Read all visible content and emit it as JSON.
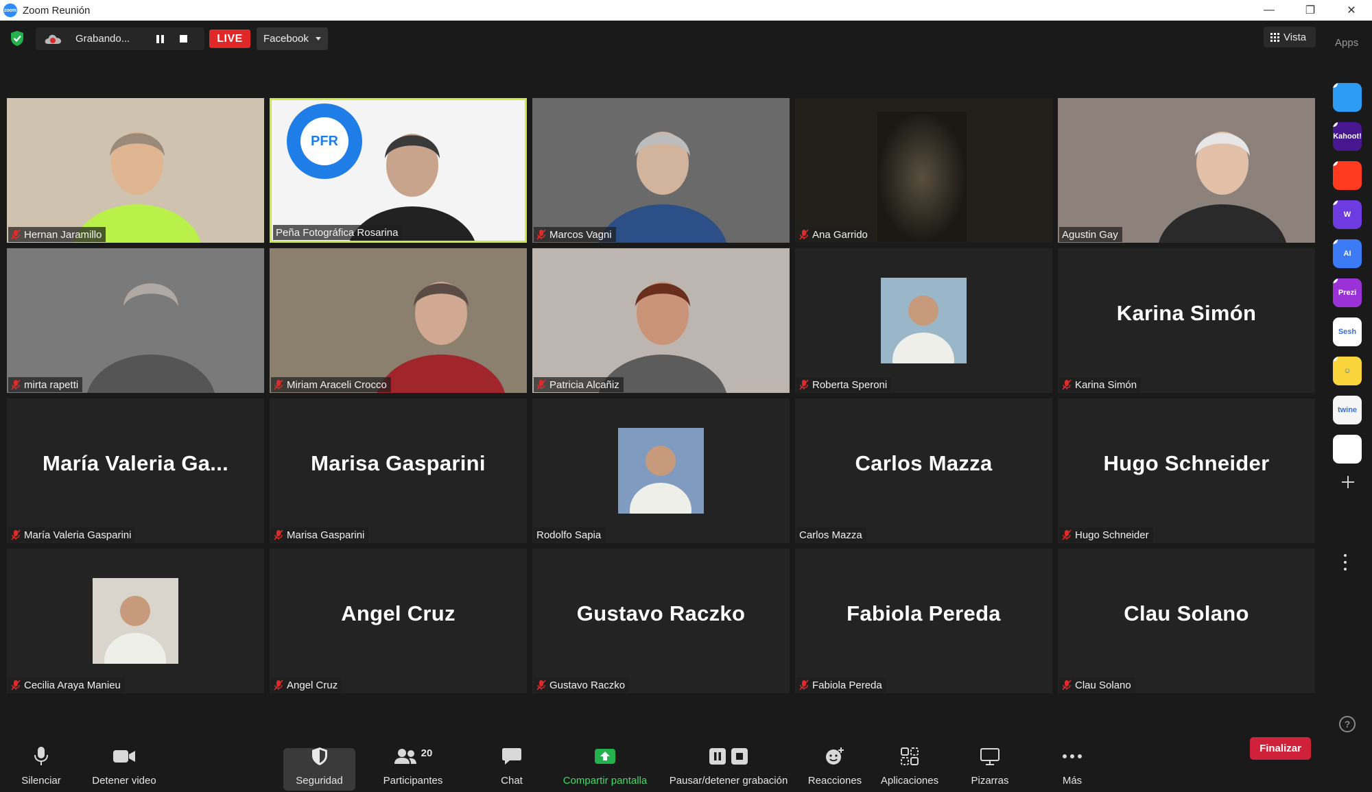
{
  "window": {
    "title": "Zoom Reunión",
    "logo_text": "zoom",
    "minimize": "—",
    "maximize": "❐",
    "close": "✕"
  },
  "topbar": {
    "recording_status": "Grabando...",
    "live_label": "LIVE",
    "stream_target": "Facebook",
    "view_label": "Vista"
  },
  "apps_panel": {
    "label": "Apps",
    "apps": [
      {
        "name": "stream-app",
        "color": "#2d9cf5",
        "text": ""
      },
      {
        "name": "kahoot",
        "color": "#46178f",
        "text": "Kahoot!"
      },
      {
        "name": "red-app",
        "color": "#ff3b1f",
        "text": ""
      },
      {
        "name": "wooclap",
        "color": "#6d3be0",
        "text": "W"
      },
      {
        "name": "ai-app",
        "color": "#3b7bf6",
        "text": "AI"
      },
      {
        "name": "prezi",
        "color": "#9b32d8",
        "text": "Prezi"
      },
      {
        "name": "sesh",
        "color": "#ffffff",
        "text": "Sesh"
      },
      {
        "name": "emoji-app",
        "color": "#f9d43a",
        "text": "☺"
      },
      {
        "name": "twine",
        "color": "#f5f5f5",
        "text": "twine"
      },
      {
        "name": "color-blocks-app",
        "color": "#ffffff",
        "text": ""
      }
    ]
  },
  "tiles": [
    {
      "name": "Hernan Jaramillo",
      "big": "",
      "muted": true,
      "kind": "video",
      "bg": "#8b7c68"
    },
    {
      "name": "Peña Fotográfica Rosarina",
      "big": "",
      "muted": false,
      "kind": "video",
      "bg": "#e9e9e9",
      "active": true,
      "logo_text": "PFR"
    },
    {
      "name": "Marcos Vagni",
      "big": "",
      "muted": true,
      "kind": "video",
      "bg": "#4a4a4a"
    },
    {
      "name": "Ana Garrido",
      "big": "",
      "muted": true,
      "kind": "video",
      "bg": "#22201a"
    },
    {
      "name": "Agustin Gay",
      "big": "",
      "muted": false,
      "kind": "video",
      "bg": "#6e645e"
    },
    {
      "name": "mirta rapetti",
      "big": "",
      "muted": true,
      "kind": "video",
      "bg": "#5d5d5d"
    },
    {
      "name": "Miriam Araceli Crocco",
      "big": "",
      "muted": true,
      "kind": "video",
      "bg": "#6b5f50"
    },
    {
      "name": "Patricia Alcañiz",
      "big": "",
      "muted": true,
      "kind": "video",
      "bg": "#a39a94"
    },
    {
      "name": "Roberta Speroni",
      "big": "",
      "muted": true,
      "kind": "avatar",
      "bg": "#232323",
      "avatar_bg": "#9ab7c9"
    },
    {
      "name": "Karina Simón",
      "big": "Karina Simón",
      "muted": true,
      "kind": "name",
      "bg": "#232323"
    },
    {
      "name": "María Valeria Gasparini",
      "big": "María Valeria Ga...",
      "muted": true,
      "kind": "name",
      "bg": "#232323"
    },
    {
      "name": "Marisa Gasparini",
      "big": "Marisa Gasparini",
      "muted": true,
      "kind": "name",
      "bg": "#232323"
    },
    {
      "name": "Rodolfo Sapia",
      "big": "",
      "muted": false,
      "kind": "avatar",
      "bg": "#232323",
      "avatar_bg": "#7f9bbf"
    },
    {
      "name": "Carlos Mazza",
      "big": "Carlos Mazza",
      "muted": false,
      "kind": "name",
      "bg": "#232323"
    },
    {
      "name": "Hugo Schneider",
      "big": "Hugo Schneider",
      "muted": true,
      "kind": "name",
      "bg": "#232323"
    },
    {
      "name": "Cecilia Araya Manieu",
      "big": "",
      "muted": true,
      "kind": "avatar",
      "bg": "#232323",
      "avatar_bg": "#d9d4cc"
    },
    {
      "name": "Angel Cruz",
      "big": "Angel Cruz",
      "muted": true,
      "kind": "name",
      "bg": "#232323"
    },
    {
      "name": "Gustavo Raczko",
      "big": "Gustavo Raczko",
      "muted": true,
      "kind": "name",
      "bg": "#232323"
    },
    {
      "name": "Fabiola Pereda",
      "big": "Fabiola Pereda",
      "muted": true,
      "kind": "name",
      "bg": "#232323"
    },
    {
      "name": "Clau Solano",
      "big": "Clau Solano",
      "muted": true,
      "kind": "name",
      "bg": "#232323"
    }
  ],
  "toolbar": {
    "mute": "Silenciar",
    "stop_video": "Detener video",
    "security": "Seguridad",
    "participants": "Participantes",
    "participants_count": "20",
    "chat": "Chat",
    "share_screen": "Compartir pantalla",
    "pause_recording": "Pausar/detener grabación",
    "reactions": "Reacciones",
    "apps": "Aplicaciones",
    "whiteboards": "Pizarras",
    "more": "Más",
    "end": "Finalizar"
  },
  "colors": {
    "accent_green": "#22c55e",
    "live_red": "#e02828",
    "end_red": "#d0213a",
    "active_speaker": "#cdeb3b",
    "mute_red": "#e02b2b"
  }
}
